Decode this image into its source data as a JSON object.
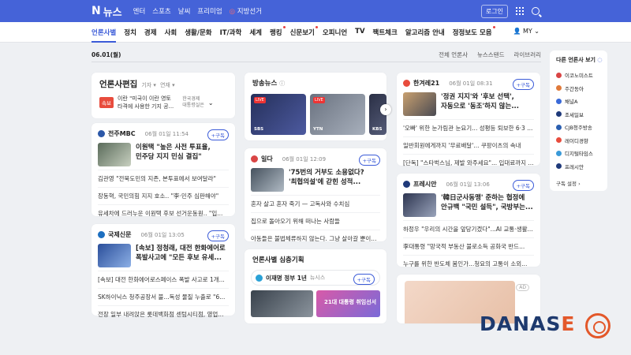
{
  "topbar": {
    "logo": "N",
    "service": "뉴스",
    "nav": [
      "엔터",
      "스포츠",
      "날씨",
      "프리미엄"
    ],
    "election": "지방선거",
    "login": "로그인"
  },
  "mainnav": {
    "items": [
      "언론사별",
      "정치",
      "경제",
      "사회",
      "생활/문화",
      "IT/과학",
      "세계",
      "랭킹",
      "신문보기",
      "오피니언",
      "TV",
      "팩트체크",
      "알고리즘 안내",
      "정정보도 모음"
    ],
    "my": "MY"
  },
  "subbar": {
    "date": "06.01(월)",
    "links": [
      "전체 언론사",
      "뉴스스탠드",
      "라이브러리"
    ]
  },
  "edit": {
    "title": "언론사편집",
    "opt1": "기자",
    "opt2": "연재",
    "ad_badge": "속보",
    "ad_line1": "이란 \"미국이 이란 영토",
    "ad_line2": "타격에 사용한 기지 공...",
    "ad_src": "한국경제",
    "ad_src2": "대통령실은"
  },
  "card1": {
    "press": "전주MBC",
    "time": "06월 01일 11:54",
    "sub": "+구독",
    "headline1": "이원택 \"높은 사전 투표율,",
    "headline2": "민주당 지지 민심 결집\"",
    "rows": [
      "김관영 \"전북도민의 지존, 본투표에서 보여달라\"",
      "장동혁, 국민의힘 지지 호소.. \"李·민주 심판해야\"",
      "유세차에 드러누운 이원택 후보 선거운동원.. \"입..."
    ]
  },
  "card2": {
    "press": "국제신문",
    "time": "06월 01일 13:05",
    "sub": "+구독",
    "headline1": "[속보] 정청래, 대전 한화에어로",
    "headline2": "폭발사고에 \"모든 후보 유세...",
    "rows": [
      "[속보] 대전 한화에어로스페이스 폭발 사고로 1개...",
      "SK하이닉스 청주공장서 불...독성 물질 누출로 \"6...",
      "전장 일부 내려앉은 롯데백화점 센텀시티점, 영업..."
    ]
  },
  "broadcast": {
    "title": "방송뉴스",
    "tv": [
      "SBS",
      "YTN",
      "KBS"
    ],
    "live": "LIVE"
  },
  "card3": {
    "press": "일다",
    "time": "06월 01일 12:09",
    "sub": "+구독",
    "headline1": "'75번의 거부도 소용없다?",
    "headline2": "'최협의설'에 갇힌 성적...",
    "rows": [
      "혼자 살고 혼자 죽기 — 고독사와 수치심",
      "집으로 돌아오기 위해 떠나는 사람들",
      "아동들은 불법체류하지 않는다. 그냥 살아갈 뿐이..."
    ]
  },
  "deep": {
    "title": "언론사별 심층기획",
    "series": "이재명 정부 1년",
    "press": "뉴시스",
    "sub": "+구독",
    "thumb_text": "21대 대통령 취임선서"
  },
  "card4": {
    "press": "한겨레21",
    "time": "06월 01일 08:31",
    "sub": "+구독",
    "headline1": "'정권 지지'와 '후보 선택',",
    "headline2": "자동으로 '동조'하지 않는...",
    "rows": [
      "'오빠' 위한 눈가림관 눈요기... 성평등 퇴보한 6·3 ...",
      "일반회원에게까지 '무료배달'... 쿠팡이츠의 속내",
      "[단독] \"스타벅스님, 제발 와주세요\"... 입대료까지 ..."
    ]
  },
  "card5": {
    "press": "프레시안",
    "time": "06월 01일 13:06",
    "sub": "+구독",
    "headline1": "'韓日군사동맹' 준하는 협정에",
    "headline2": "안규백 \"국민 설득\", 국방부는...",
    "rows": [
      "하정우 \"우리의 시간을 앞당기겠다\"...AI 교통·생활...",
      "李대통령 \"망국적 부동산 불로소득 공화국 반드...",
      "누구를 위한 반도체 봄인가...청요의 고통이 소외..."
    ]
  },
  "others": {
    "title": "다른 언론사 보기",
    "items": [
      "이코노미스트",
      "주간동아",
      "채널A",
      "조세일보",
      "CJB청주방송",
      "레이디경향",
      "디지털타임스",
      "프레시안"
    ],
    "setting": "구독 설정"
  },
  "ad": {
    "badge": "AD"
  },
  "watermark": {
    "a": "DANAS",
    "b": "E"
  },
  "colors": {
    "brand": "#4563d8",
    "accent": "#3b5bd8"
  }
}
